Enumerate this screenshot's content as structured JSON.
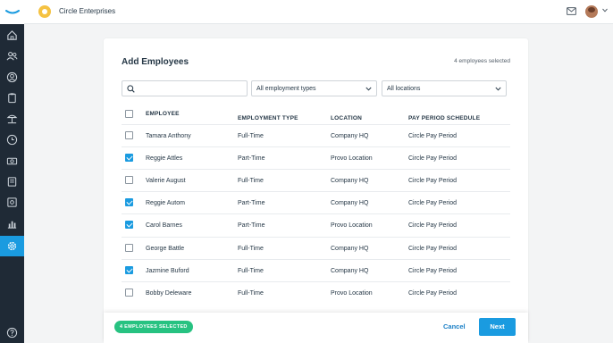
{
  "topbar": {
    "company_name": "Circle Enterprises"
  },
  "sidebar": {
    "icons": [
      "home-icon",
      "people-icon",
      "user-circle-icon",
      "clipboard-icon",
      "beach-icon",
      "clock-icon",
      "money-icon",
      "book-icon",
      "reports-icon",
      "calendar-icon",
      "chart-icon",
      "settings-icon",
      "help-icon"
    ],
    "active": "settings-icon"
  },
  "card": {
    "title": "Add Employees",
    "selected_count": "4 employees selected",
    "search": {
      "placeholder": ""
    },
    "employment_filter": "All employment types",
    "location_filter": "All locations"
  },
  "table": {
    "headers": {
      "employee": "EMPLOYEE",
      "employment_type": "EMPLOYMENT TYPE",
      "location": "LOCATION",
      "pay_period": "PAY PERIOD SCHEDULE"
    },
    "rows": [
      {
        "name": "Tamara Anthony",
        "type": "Full-Time",
        "location": "Company HQ",
        "pay": "Circle Pay Period",
        "checked": false
      },
      {
        "name": "Reggie Attles",
        "type": "Part-Time",
        "location": "Provo Location",
        "pay": "Circle Pay Period",
        "checked": true
      },
      {
        "name": "Valerie August",
        "type": "Full-Time",
        "location": "Company HQ",
        "pay": "Circle Pay Period",
        "checked": false
      },
      {
        "name": "Reggie Autom",
        "type": "Part-Time",
        "location": "Company HQ",
        "pay": "Circle Pay Period",
        "checked": true
      },
      {
        "name": "Carol Barnes",
        "type": "Part-Time",
        "location": "Provo Location",
        "pay": "Circle Pay Period",
        "checked": true
      },
      {
        "name": "George Battle",
        "type": "Full-Time",
        "location": "Company HQ",
        "pay": "Circle Pay Period",
        "checked": false
      },
      {
        "name": "Jazmine Buford",
        "type": "Full-Time",
        "location": "Company HQ",
        "pay": "Circle Pay Period",
        "checked": true
      },
      {
        "name": "Bobby Deleware",
        "type": "Full-Time",
        "location": "Provo Location",
        "pay": "Circle Pay Period",
        "checked": false
      }
    ]
  },
  "footer": {
    "selected_pill": "4 EMPLOYEES SELECTED",
    "cancel_label": "Cancel",
    "next_label": "Next"
  },
  "colors": {
    "accent": "#1a9be0",
    "success": "#27c281",
    "sidebar": "#1f2a36"
  }
}
